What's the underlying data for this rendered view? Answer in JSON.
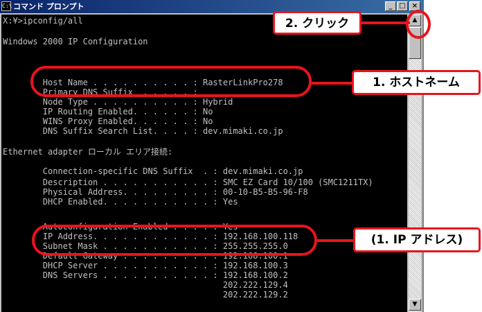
{
  "window": {
    "title": "コマンド プロンプト",
    "icon_label": "C:\\",
    "buttons": {
      "minimize": "_",
      "maximize": "□",
      "close": "×"
    }
  },
  "console_lines": [
    "X:¥>ipconfig/all",
    "",
    "Windows 2000 IP Configuration",
    "",
    "        Host Name . . . . . . . . . . : RasterLinkPro278",
    "        Primary DNS Suffix  . . . . . :",
    "        Node Type . . . . . . . . . . : Hybrid",
    "        IP Routing Enabled. . . . . . : No",
    "        WINS Proxy Enabled. . . . . . : No",
    "        DNS Suffix Search List. . . . : dev.mimaki.co.jp",
    "",
    "Ethernet adapter ローカル エリア接続:",
    "",
    "        Connection-specific DNS Suffix  . : dev.mimaki.co.jp",
    "        Description . . . . . . . . . . . : SMC EZ Card 10/100 (SMC1211TX)",
    "        Physical Address. . . . . . . . . : 00-10-B5-B5-96-F8",
    "        DHCP Enabled. . . . . . . . . . . : Yes",
    "        Autoconfiguration Enabled . . . . : Yes",
    "        IP Address. . . . . . . . . . . . : 192.168.100.118",
    "        Subnet Mask . . . . . . . . . . . : 255.255.255.0",
    "        Default Gateway . . . . . . . . . : 192.168.100.1",
    "        DHCP Server . . . . . . . . . . . : 192.168.100.3",
    "        DNS Servers . . . . . . . . . . . : 192.168.100.2",
    "                                            202.222.129.4",
    "                                            202.222.129.2"
  ],
  "annotations": {
    "click": "2. クリック",
    "hostname": "1. ホストネーム",
    "ip_address": "(1. IP アドレス)"
  },
  "colors": {
    "accent_red": "#e8141c",
    "console_bg": "#000000",
    "console_text": "#c0c0c0",
    "title_blue": "#0a246a"
  },
  "icons": {
    "scroll_up": "▲",
    "scroll_down": "▼"
  }
}
